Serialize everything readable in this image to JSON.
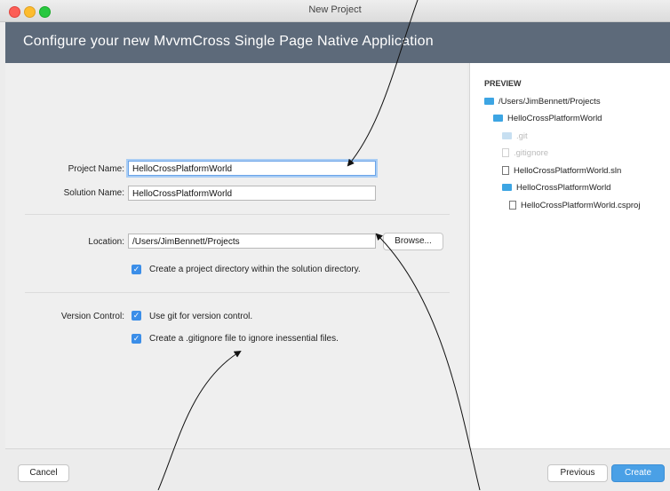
{
  "window": {
    "title": "New Project"
  },
  "banner": {
    "text": "Configure your new MvvmCross Single Page Native Application"
  },
  "form": {
    "project_name_label": "Project Name:",
    "project_name_value": "HelloCrossPlatformWorld",
    "solution_name_label": "Solution Name:",
    "solution_name_value": "HelloCrossPlatformWorld",
    "location_label": "Location:",
    "location_value": "/Users/JimBennett/Projects",
    "browse_label": "Browse...",
    "create_dir_label": "Create a project directory within the solution directory.",
    "create_dir_checked": true,
    "version_control_label": "Version Control:",
    "use_git_label": "Use git for version control.",
    "use_git_checked": true,
    "gitignore_label": "Create a .gitignore file to ignore inessential files.",
    "gitignore_checked": true
  },
  "preview": {
    "title": "PREVIEW",
    "tree": [
      {
        "label": "/Users/JimBennett/Projects",
        "icon": "folder-icon",
        "dim": false
      },
      {
        "label": "HelloCrossPlatformWorld",
        "icon": "folder-icon",
        "dim": false
      },
      {
        "label": ".git",
        "icon": "folder-icon",
        "dim": true
      },
      {
        "label": ".gitignore",
        "icon": "file-icon",
        "dim": true
      },
      {
        "label": "HelloCrossPlatformWorld.sln",
        "icon": "file-icon",
        "dim": false
      },
      {
        "label": "HelloCrossPlatformWorld",
        "icon": "folder-icon",
        "dim": false
      },
      {
        "label": "HelloCrossPlatformWorld.csproj",
        "icon": "file-icon",
        "dim": false
      }
    ]
  },
  "footer": {
    "cancel_label": "Cancel",
    "previous_label": "Previous",
    "create_label": "Create"
  },
  "colors": {
    "banner": "#5d6a7a",
    "accent": "#4aa0e6",
    "checkbox": "#3b8ee8",
    "folder": "#3da5e3"
  }
}
